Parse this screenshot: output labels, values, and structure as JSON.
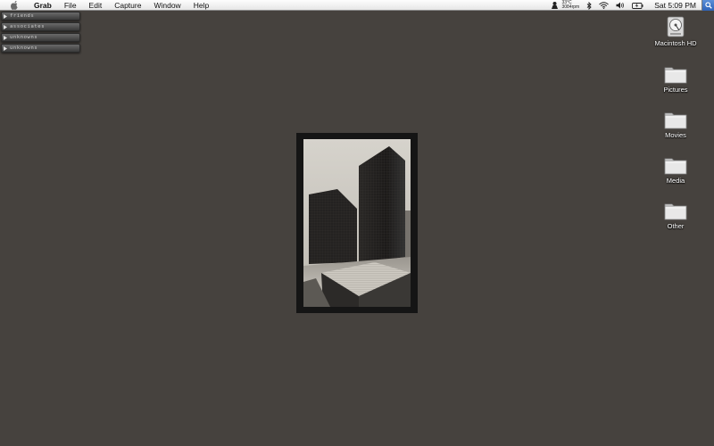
{
  "menubar": {
    "app_name": "Grab",
    "items": [
      "File",
      "Edit",
      "Capture",
      "Window",
      "Help"
    ],
    "weather_temp": "33°C",
    "weather_rpm": "3084rpm",
    "clock": "Sat 5:09 PM"
  },
  "drawers": [
    {
      "label": "friends"
    },
    {
      "label": "associates"
    },
    {
      "label": "unknowns"
    },
    {
      "label": "unknowns"
    }
  ],
  "desktop_icons": [
    {
      "label": "Macintosh HD",
      "type": "harddisk"
    },
    {
      "label": "Pictures",
      "type": "folder"
    },
    {
      "label": "Movies",
      "type": "folder"
    },
    {
      "label": "Media",
      "type": "folder"
    },
    {
      "label": "Other",
      "type": "folder"
    }
  ],
  "colors": {
    "desktop": "#46423e",
    "menubar": "#eeeeee",
    "frame": "#151515"
  },
  "photo": {
    "subject": "black-and-white-skyscrapers-photo"
  }
}
